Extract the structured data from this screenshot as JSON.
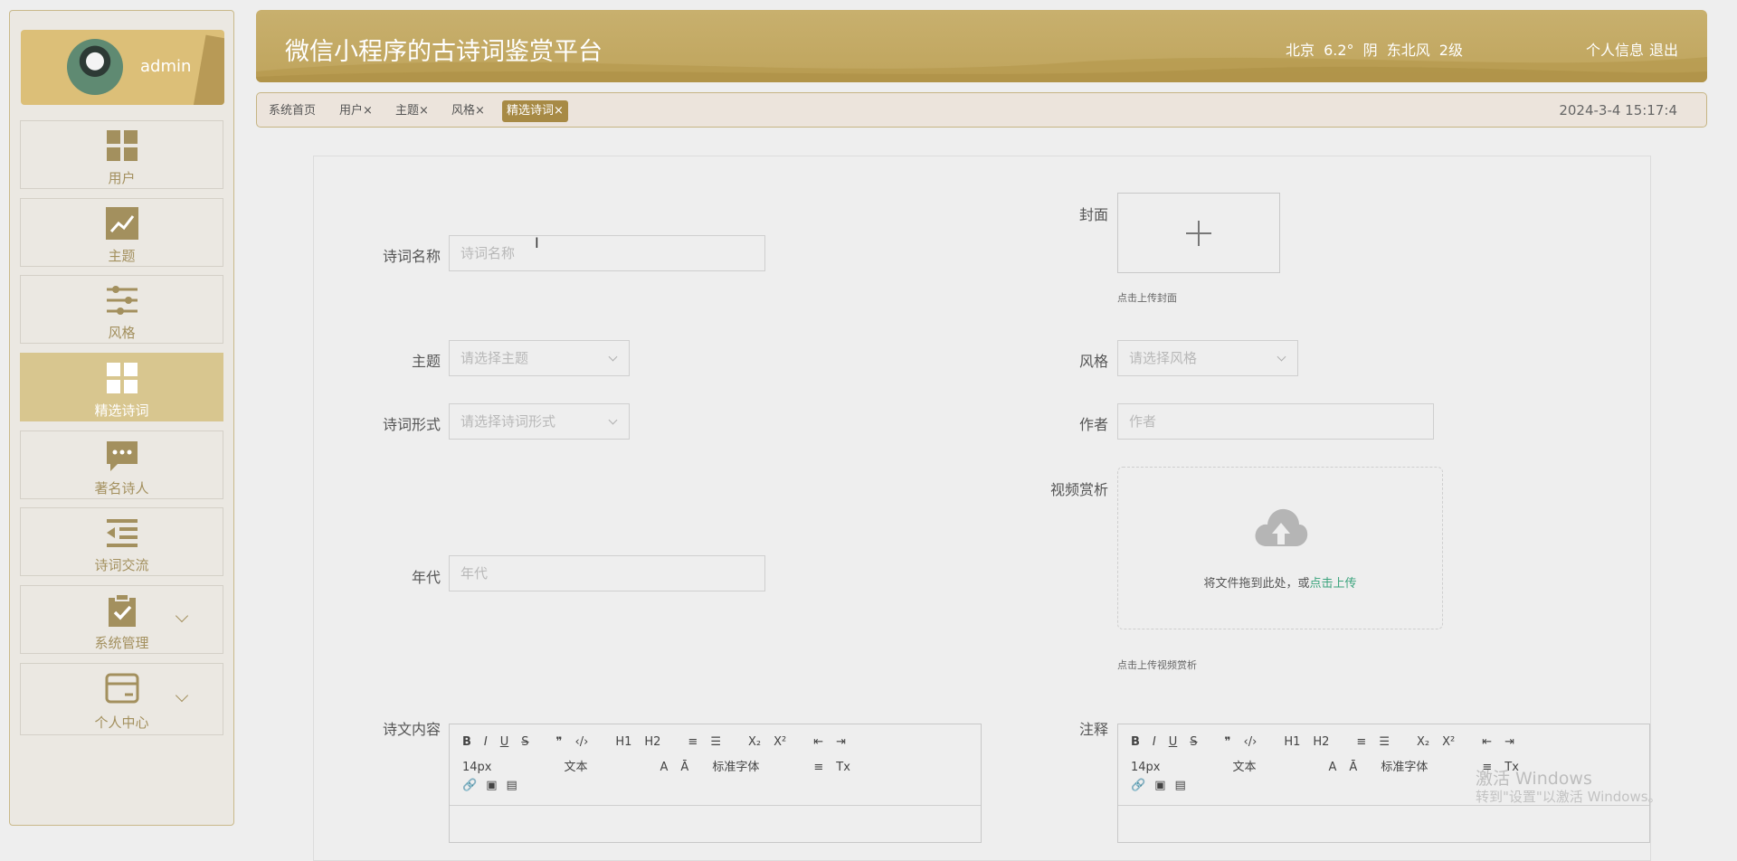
{
  "user": {
    "name": "admin"
  },
  "sidebar": {
    "items": [
      {
        "label": "用户",
        "icon": "grid-icon"
      },
      {
        "label": "主题",
        "icon": "trend-chart-icon"
      },
      {
        "label": "风格",
        "icon": "sliders-icon"
      },
      {
        "label": "精选诗词",
        "icon": "grid-icon",
        "active": true
      },
      {
        "label": "著名诗人",
        "icon": "chat-bubble-icon"
      },
      {
        "label": "诗词交流",
        "icon": "list-indent-icon"
      },
      {
        "label": "系统管理",
        "icon": "clipboard-check-icon",
        "expandable": true
      },
      {
        "label": "个人中心",
        "icon": "card-icon",
        "expandable": true
      }
    ]
  },
  "header": {
    "title": "微信小程序的古诗词鉴赏平台",
    "weather": "北京 6.2° 阴 东北风 2级",
    "profile_link": "个人信息",
    "logout_link": "退出"
  },
  "tabs": [
    {
      "label": "系统首页"
    },
    {
      "label": "用户×"
    },
    {
      "label": "主题×"
    },
    {
      "label": "风格×"
    },
    {
      "label": "精选诗词×",
      "active": true
    }
  ],
  "clock": "2024-3-4 15:17:4",
  "form": {
    "name_label": "诗词名称",
    "name_placeholder": "诗词名称",
    "cover_label": "封面",
    "cover_hint": "点击上传封面",
    "theme_label": "主题",
    "theme_placeholder": "请选择主题",
    "style_label": "风格",
    "style_placeholder": "请选择风格",
    "form_label": "诗词形式",
    "form_placeholder": "请选择诗词形式",
    "author_label": "作者",
    "author_placeholder": "作者",
    "video_label": "视频赏析",
    "video_drop_text": "将文件拖到此处，或",
    "video_drop_link": "点击上传",
    "video_hint": "点击上传视频赏析",
    "era_label": "年代",
    "era_placeholder": "年代",
    "content_label": "诗文内容",
    "notes_label": "注释"
  },
  "editor_toolbar": {
    "row1": [
      "B",
      "I",
      "U",
      "S",
      "❞",
      "‹/›",
      "H1",
      "H2",
      "≡",
      "☰",
      "X₂",
      "X²",
      "⇤",
      "⇥"
    ],
    "size": "14px",
    "format": "文本",
    "font": "标准字体",
    "row2_icons": [
      "A",
      "Ā",
      "≡",
      "Tx"
    ],
    "row3": [
      "🔗",
      "▣",
      "▤"
    ]
  },
  "watermark": {
    "line1": "激活 Windows",
    "line2": "转到\"设置\"以激活 Windows。"
  },
  "colors": {
    "accent": "#a78a45",
    "header": "#c3a861",
    "sidebar_active": "#d8c68f"
  }
}
